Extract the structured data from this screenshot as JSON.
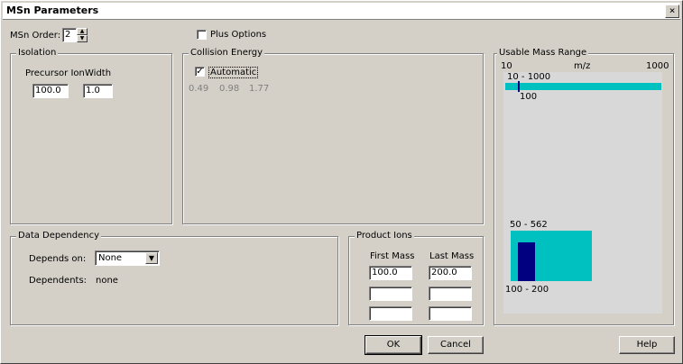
{
  "window": {
    "title": "MSn Parameters",
    "close_glyph": "×"
  },
  "msn_order": {
    "label": "MSn Order:",
    "value": "2"
  },
  "plus_options": {
    "label": "Plus Options",
    "checked": false
  },
  "isolation": {
    "title": "Isolation",
    "precursor_label": "Precursor Ion",
    "width_label": "Width",
    "precursor_value": "100.0",
    "width_value": "1.0"
  },
  "collision": {
    "title": "Collision Energy",
    "automatic_label": "Automatic",
    "automatic_checked": true,
    "values": [
      "0.49",
      "0.98",
      "1.77"
    ]
  },
  "mass_range": {
    "title": "Usable Mass Range",
    "axis_min": "10",
    "axis_unit": "m/z",
    "axis_max": "1000",
    "top_range_label": "10 - 1000",
    "top_marker_label": "100",
    "lower_range_label": "50 - 562",
    "lower_bottom_label": "100 - 200",
    "colors": {
      "range_fill": "#00c0c0",
      "marker": "#000080",
      "panel_bg": "#d8d8d8"
    }
  },
  "data_dependency": {
    "title": "Data Dependency",
    "depends_on_label": "Depends on:",
    "depends_on_value": "None",
    "dependents_label": "Dependents:",
    "dependents_value": "none"
  },
  "product_ions": {
    "title": "Product Ions",
    "first_mass_label": "First Mass",
    "last_mass_label": "Last Mass",
    "rows": [
      {
        "first": "100.0",
        "last": "200.0"
      },
      {
        "first": "",
        "last": ""
      },
      {
        "first": "",
        "last": ""
      }
    ]
  },
  "buttons": {
    "ok": "OK",
    "cancel": "Cancel",
    "help": "Help"
  }
}
